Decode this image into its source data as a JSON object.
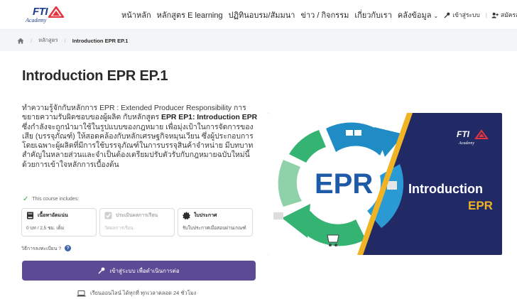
{
  "logo": {
    "brand": "FTI",
    "sub": "Academy"
  },
  "nav": {
    "home": "หน้าหลัก",
    "courses": "หลักสูตร E learning",
    "calendar": "ปฏิทินอบรม/สัมมนา",
    "news": "ข่าว / กิจกรรม",
    "about": "เกี่ยวกับเรา",
    "library": "คลังข้อมูล",
    "login": "เข้าสู่ระบบ",
    "register": "สมัครสมาชิก"
  },
  "breadcrumb": {
    "level1": "หลักสูตร",
    "current": "Introduction EPR EP.1"
  },
  "course": {
    "title": "Introduction EPR EP.1",
    "desc_p1": "ทำความรู้จักกับหลักการ EPR : Extended Producer Responsibility การขยายความรับผิดชอบของผู้ผลิต กับหลักสูตร ",
    "desc_bold": "EPR EP1: Introduction EPR",
    "desc_p2": " ซึ่งกำลังจะถูกนำมาใช้ในรูปแบบของกฎหมาย เพื่อมุ่งเป้าในการจัดการของเสีย (บรรจุภัณฑ์) ให้สอดคล้องกับหลักเศรษฐกิจหมุนเวียน ซึ่งผู้ประกอบการ โดยเฉพาะผู้ผลิตที่มีการใช้บรรจุภัณฑ์ในการบรรจุสินค้าจำหน่าย มีบทบาทสำคัญในหลายส่วนและจำเป็นต้องเตรียมปรับตัวรับกับกฎหมายฉบับใหม่นี้ด้วยการเข้าใจหลักการเบื้องต้น",
    "includes_label": "This course includes:",
    "cards": [
      {
        "title": "เนื้อหาอัดแน่น",
        "sub": "0 บท / 2.5 ชม. เต็ม"
      },
      {
        "title": "ประเมินผลการเรียน",
        "sub": "วัดผลการเรียน"
      },
      {
        "title": "ใบประกาศ",
        "sub": "รับใบประกาศเมื่อสอบผ่านเกณฑ์"
      }
    ],
    "howto": "วิธีการลงทะเบียน ?",
    "login_button": "เข้าสู่ระบบ เพื่อดำเนินการต่อ",
    "online_note": "เรียนออนไลน์ ได้ทุกที่ ทุกเวลาตลอด 24 ชั่วโมง"
  },
  "banner": {
    "big": "EPR",
    "intro": "Introduction",
    "epr": "EPR",
    "brand": "FTI",
    "sub": "Academy"
  },
  "colors": {
    "primary_button": "#5c4a94",
    "banner_bg": "#222a66",
    "accent_yellow": "#f0b323",
    "arrow_green": "#35b373",
    "arrow_blue": "#1f8cc6"
  }
}
